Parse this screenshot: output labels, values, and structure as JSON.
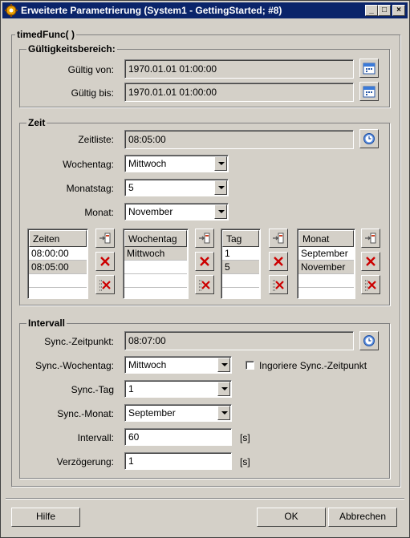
{
  "window": {
    "title": "Erweiterte Parametrierung (System1 - GettingStarted; #8)",
    "minimize_glyph": "_",
    "maximize_glyph": "□",
    "close_glyph": "×"
  },
  "main": {
    "title": "timedFunc( )"
  },
  "validity": {
    "title": "Gültigkeitsbereich:",
    "from_label": "Gültig von:",
    "from_value": "1970.01.01 01:00:00",
    "to_label": "Gültig bis:",
    "to_value": "1970.01.01 01:00:00"
  },
  "time": {
    "title": "Zeit",
    "timelist_label": "Zeitliste:",
    "timelist_value": "08:05:00",
    "weekday_label": "Wochentag:",
    "weekday_value": "Mittwoch",
    "monthday_label": "Monatstag:",
    "monthday_value": "5",
    "month_label": "Monat:",
    "month_value": "November",
    "lists": [
      {
        "header": "Zeiten",
        "items": [
          "08:00:00",
          "08:05:00"
        ]
      },
      {
        "header": "Wochentag",
        "items": [
          "Mittwoch"
        ]
      },
      {
        "header": "Tag",
        "items": [
          "1",
          "5"
        ]
      },
      {
        "header": "Monat",
        "items": [
          "September",
          "November"
        ]
      }
    ]
  },
  "interval": {
    "title": "Intervall",
    "sync_time_label": "Sync.-Zeitpunkt:",
    "sync_time_value": "08:07:00",
    "sync_weekday_label": "Sync.-Wochentag:",
    "sync_weekday_value": "Mittwoch",
    "ignore_label": "Ingoriere Sync.-Zeitpunkt",
    "ignore_checked": false,
    "sync_day_label": "Sync.-Tag",
    "sync_day_value": "1",
    "sync_month_label": "Sync.-Monat:",
    "sync_month_value": "September",
    "interval_label": "Intervall:",
    "interval_value": "60",
    "interval_unit": "[s]",
    "delay_label": "Verzögerung:",
    "delay_value": "1",
    "delay_unit": "[s]"
  },
  "footer": {
    "help": "Hilfe",
    "ok": "OK",
    "cancel": "Abbrechen"
  },
  "colors": {
    "titlebar": "#0a246a",
    "face": "#d4d0c8",
    "delete_x": "#cc0000"
  }
}
